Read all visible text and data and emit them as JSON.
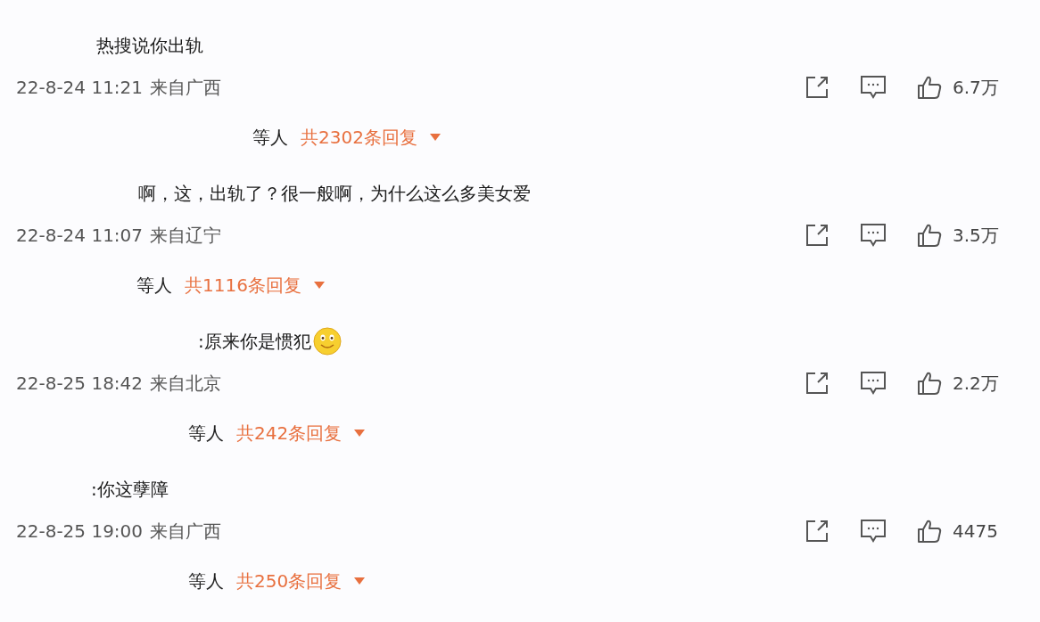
{
  "comments": [
    {
      "text": "热搜说你出轨",
      "emoji": false,
      "time": "22-8-24 11:21",
      "location": "来自广西",
      "likes": "6.7万",
      "replies_prefix": "等人",
      "replies": "共2302条回复"
    },
    {
      "text": "啊，这，出轨了？很一般啊，为什么这么多美女爱",
      "emoji": false,
      "time": "22-8-24 11:07",
      "location": "来自辽宁",
      "likes": "3.5万",
      "replies_prefix": "等人",
      "replies": "共1116条回复"
    },
    {
      "text": ":原来你是惯犯",
      "emoji": true,
      "time": "22-8-25 18:42",
      "location": "来自北京",
      "likes": "2.2万",
      "replies_prefix": "等人",
      "replies": "共242条回复"
    },
    {
      "text": ":你这孽障",
      "emoji": false,
      "time": "22-8-25 19:00",
      "location": "来自广西",
      "likes": "4475",
      "replies_prefix": "等人",
      "replies": "共250条回复"
    }
  ]
}
